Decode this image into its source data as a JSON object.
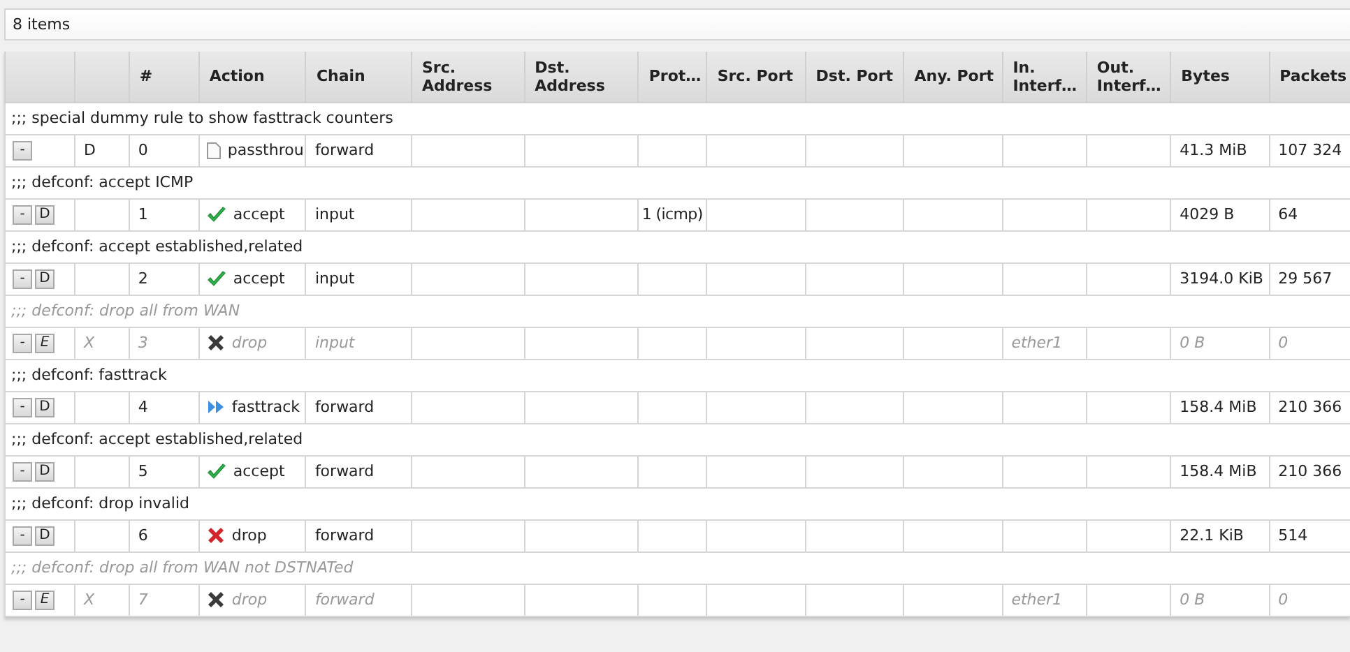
{
  "status": "8 items",
  "columns": [
    "#",
    "Action",
    "Chain",
    "Src. Address",
    "Dst. Address",
    "Prot…",
    "Src. Port",
    "Dst. Port",
    "Any. Port",
    "In. Interf…",
    "Out. Interf…",
    "Bytes",
    "Packets"
  ],
  "rules": [
    {
      "comment": ";;; special dummy rule to show fasttrack counters",
      "disabled": false,
      "buttons": [
        "-"
      ],
      "flag": "D",
      "number": "0",
      "action": {
        "kind": "passthrough",
        "label": "passthrou"
      },
      "chain": "forward",
      "bytes": "41.3 MiB",
      "packets": "107 324"
    },
    {
      "comment": ";;; defconf: accept ICMP",
      "disabled": false,
      "buttons": [
        "-",
        "D"
      ],
      "number": "1",
      "action": {
        "kind": "accept",
        "label": "accept"
      },
      "chain": "input",
      "protocol": "1 (icmp)",
      "bytes": "4029 B",
      "packets": "64"
    },
    {
      "comment": ";;; defconf: accept established,related",
      "disabled": false,
      "buttons": [
        "-",
        "D"
      ],
      "number": "2",
      "action": {
        "kind": "accept",
        "label": "accept"
      },
      "chain": "input",
      "bytes": "3194.0 KiB",
      "packets": "29 567"
    },
    {
      "comment": ";;; defconf: drop all from WAN",
      "disabled": true,
      "buttons": [
        "-",
        "E"
      ],
      "flag": "X",
      "number": "3",
      "action": {
        "kind": "drop",
        "label": "drop"
      },
      "chain": "input",
      "in_interface": "ether1",
      "bytes": "0 B",
      "packets": "0"
    },
    {
      "comment": ";;; defconf: fasttrack",
      "disabled": false,
      "buttons": [
        "-",
        "D"
      ],
      "number": "4",
      "action": {
        "kind": "fasttrack",
        "label": "fasttrack"
      },
      "chain": "forward",
      "bytes": "158.4 MiB",
      "packets": "210 366"
    },
    {
      "comment": ";;; defconf: accept established,related",
      "disabled": false,
      "buttons": [
        "-",
        "D"
      ],
      "number": "5",
      "action": {
        "kind": "accept",
        "label": "accept"
      },
      "chain": "forward",
      "bytes": "158.4 MiB",
      "packets": "210 366"
    },
    {
      "comment": ";;; defconf: drop invalid",
      "disabled": false,
      "buttons": [
        "-",
        "D"
      ],
      "number": "6",
      "action": {
        "kind": "drop",
        "label": "drop"
      },
      "chain": "forward",
      "bytes": "22.1 KiB",
      "packets": "514"
    },
    {
      "comment": ";;; defconf: drop all from WAN not DSTNATed",
      "disabled": true,
      "buttons": [
        "-",
        "E"
      ],
      "flag": "X",
      "number": "7",
      "action": {
        "kind": "drop",
        "label": "drop"
      },
      "chain": "forward",
      "in_interface": "ether1",
      "bytes": "0 B",
      "packets": "0"
    }
  ]
}
